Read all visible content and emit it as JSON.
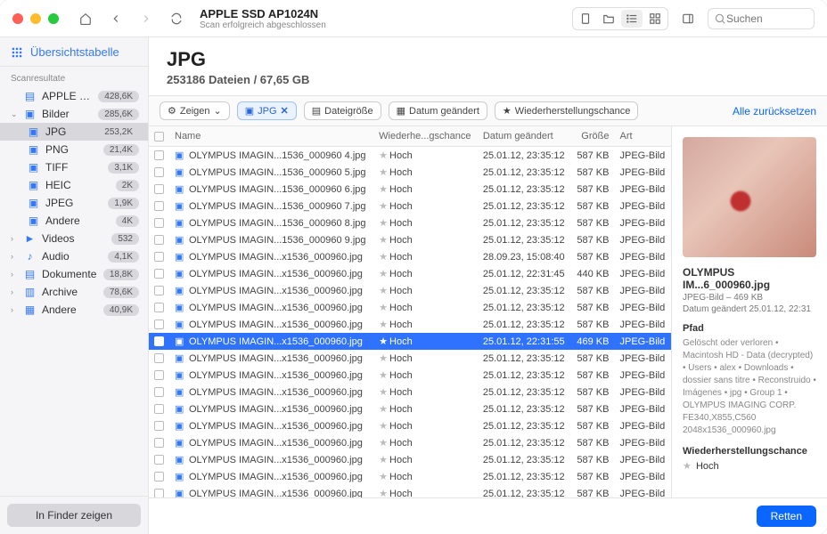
{
  "titlebar": {
    "disk_name": "APPLE SSD AP1024N",
    "scan_status": "Scan erfolgreich abgeschlossen",
    "search_placeholder": "Suchen"
  },
  "sidebar": {
    "overview_label": "Übersichtstabelle",
    "section_label": "Scanresultate",
    "disk_item": {
      "label": "APPLE SSD AP...",
      "badge": "428,6K"
    },
    "items": [
      {
        "label": "Bilder",
        "badge": "285,6K",
        "expanded": true,
        "children": [
          {
            "label": "JPG",
            "badge": "253,2K",
            "selected": true
          },
          {
            "label": "PNG",
            "badge": "21,4K"
          },
          {
            "label": "TIFF",
            "badge": "3,1K"
          },
          {
            "label": "HEIC",
            "badge": "2K"
          },
          {
            "label": "JPEG",
            "badge": "1,9K"
          },
          {
            "label": "Andere",
            "badge": "4K"
          }
        ]
      },
      {
        "label": "Videos",
        "badge": "532"
      },
      {
        "label": "Audio",
        "badge": "4,1K"
      },
      {
        "label": "Dokumente",
        "badge": "18,8K"
      },
      {
        "label": "Archive",
        "badge": "78,6K"
      },
      {
        "label": "Andere",
        "badge": "40,9K"
      }
    ],
    "finder_btn": "In Finder zeigen"
  },
  "header": {
    "title": "JPG",
    "subtitle": "253186 Dateien / 67,65 GB"
  },
  "filters": {
    "show": "Zeigen",
    "jpg": "JPG",
    "size": "Dateigröße",
    "date": "Datum geändert",
    "chance": "Wiederherstellungschance",
    "reset": "Alle zurücksetzen"
  },
  "columns": {
    "name": "Name",
    "chance": "Wiederhe...gschance",
    "date": "Datum geändert",
    "size": "Größe",
    "type": "Art"
  },
  "rows": [
    {
      "name": "OLYMPUS IMAGIN...1536_000960 4.jpg",
      "chance": "Hoch",
      "date": "25.01.12, 23:35:12",
      "size": "587 KB",
      "type": "JPEG-Bild"
    },
    {
      "name": "OLYMPUS IMAGIN...1536_000960 5.jpg",
      "chance": "Hoch",
      "date": "25.01.12, 23:35:12",
      "size": "587 KB",
      "type": "JPEG-Bild"
    },
    {
      "name": "OLYMPUS IMAGIN...1536_000960 6.jpg",
      "chance": "Hoch",
      "date": "25.01.12, 23:35:12",
      "size": "587 KB",
      "type": "JPEG-Bild"
    },
    {
      "name": "OLYMPUS IMAGIN...1536_000960 7.jpg",
      "chance": "Hoch",
      "date": "25.01.12, 23:35:12",
      "size": "587 KB",
      "type": "JPEG-Bild"
    },
    {
      "name": "OLYMPUS IMAGIN...1536_000960 8.jpg",
      "chance": "Hoch",
      "date": "25.01.12, 23:35:12",
      "size": "587 KB",
      "type": "JPEG-Bild"
    },
    {
      "name": "OLYMPUS IMAGIN...1536_000960 9.jpg",
      "chance": "Hoch",
      "date": "25.01.12, 23:35:12",
      "size": "587 KB",
      "type": "JPEG-Bild"
    },
    {
      "name": "OLYMPUS IMAGIN...x1536_000960.jpg",
      "chance": "Hoch",
      "date": "28.09.23, 15:08:40",
      "size": "587 KB",
      "type": "JPEG-Bild"
    },
    {
      "name": "OLYMPUS IMAGIN...x1536_000960.jpg",
      "chance": "Hoch",
      "date": "25.01.12, 22:31:45",
      "size": "440 KB",
      "type": "JPEG-Bild"
    },
    {
      "name": "OLYMPUS IMAGIN...x1536_000960.jpg",
      "chance": "Hoch",
      "date": "25.01.12, 23:35:12",
      "size": "587 KB",
      "type": "JPEG-Bild"
    },
    {
      "name": "OLYMPUS IMAGIN...x1536_000960.jpg",
      "chance": "Hoch",
      "date": "25.01.12, 23:35:12",
      "size": "587 KB",
      "type": "JPEG-Bild"
    },
    {
      "name": "OLYMPUS IMAGIN...x1536_000960.jpg",
      "chance": "Hoch",
      "date": "25.01.12, 23:35:12",
      "size": "587 KB",
      "type": "JPEG-Bild"
    },
    {
      "name": "OLYMPUS IMAGIN...x1536_000960.jpg",
      "chance": "Hoch",
      "date": "25.01.12, 22:31:55",
      "size": "469 KB",
      "type": "JPEG-Bild",
      "selected": true
    },
    {
      "name": "OLYMPUS IMAGIN...x1536_000960.jpg",
      "chance": "Hoch",
      "date": "25.01.12, 23:35:12",
      "size": "587 KB",
      "type": "JPEG-Bild"
    },
    {
      "name": "OLYMPUS IMAGIN...x1536_000960.jpg",
      "chance": "Hoch",
      "date": "25.01.12, 23:35:12",
      "size": "587 KB",
      "type": "JPEG-Bild"
    },
    {
      "name": "OLYMPUS IMAGIN...x1536_000960.jpg",
      "chance": "Hoch",
      "date": "25.01.12, 23:35:12",
      "size": "587 KB",
      "type": "JPEG-Bild"
    },
    {
      "name": "OLYMPUS IMAGIN...x1536_000960.jpg",
      "chance": "Hoch",
      "date": "25.01.12, 23:35:12",
      "size": "587 KB",
      "type": "JPEG-Bild"
    },
    {
      "name": "OLYMPUS IMAGIN...x1536_000960.jpg",
      "chance": "Hoch",
      "date": "25.01.12, 23:35:12",
      "size": "587 KB",
      "type": "JPEG-Bild"
    },
    {
      "name": "OLYMPUS IMAGIN...x1536_000960.jpg",
      "chance": "Hoch",
      "date": "25.01.12, 23:35:12",
      "size": "587 KB",
      "type": "JPEG-Bild"
    },
    {
      "name": "OLYMPUS IMAGIN...x1536_000960.jpg",
      "chance": "Hoch",
      "date": "25.01.12, 23:35:12",
      "size": "587 KB",
      "type": "JPEG-Bild"
    },
    {
      "name": "OLYMPUS IMAGIN...x1536_000960.jpg",
      "chance": "Hoch",
      "date": "25.01.12, 23:35:12",
      "size": "587 KB",
      "type": "JPEG-Bild"
    },
    {
      "name": "OLYMPUS IMAGIN...x1536_000960.jpg",
      "chance": "Hoch",
      "date": "25.01.12, 23:35:12",
      "size": "587 KB",
      "type": "JPEG-Bild"
    }
  ],
  "preview": {
    "title": "OLYMPUS IM...6_000960.jpg",
    "meta1": "JPEG-Bild – 469 KB",
    "meta2": "Datum geändert 25.01.12, 22:31",
    "path_h": "Pfad",
    "path": "Gelöscht oder verloren • Macintosh HD - Data (decrypted) • Users • alex • Downloads • dossier sans titre • Reconstruido • Imágenes • jpg • Group 1 • OLYMPUS IMAGING CORP. FE340,X855,C560 2048x1536_000960.jpg",
    "chance_h": "Wiederherstellungschance",
    "chance": "Hoch"
  },
  "footer": {
    "retten": "Retten"
  }
}
